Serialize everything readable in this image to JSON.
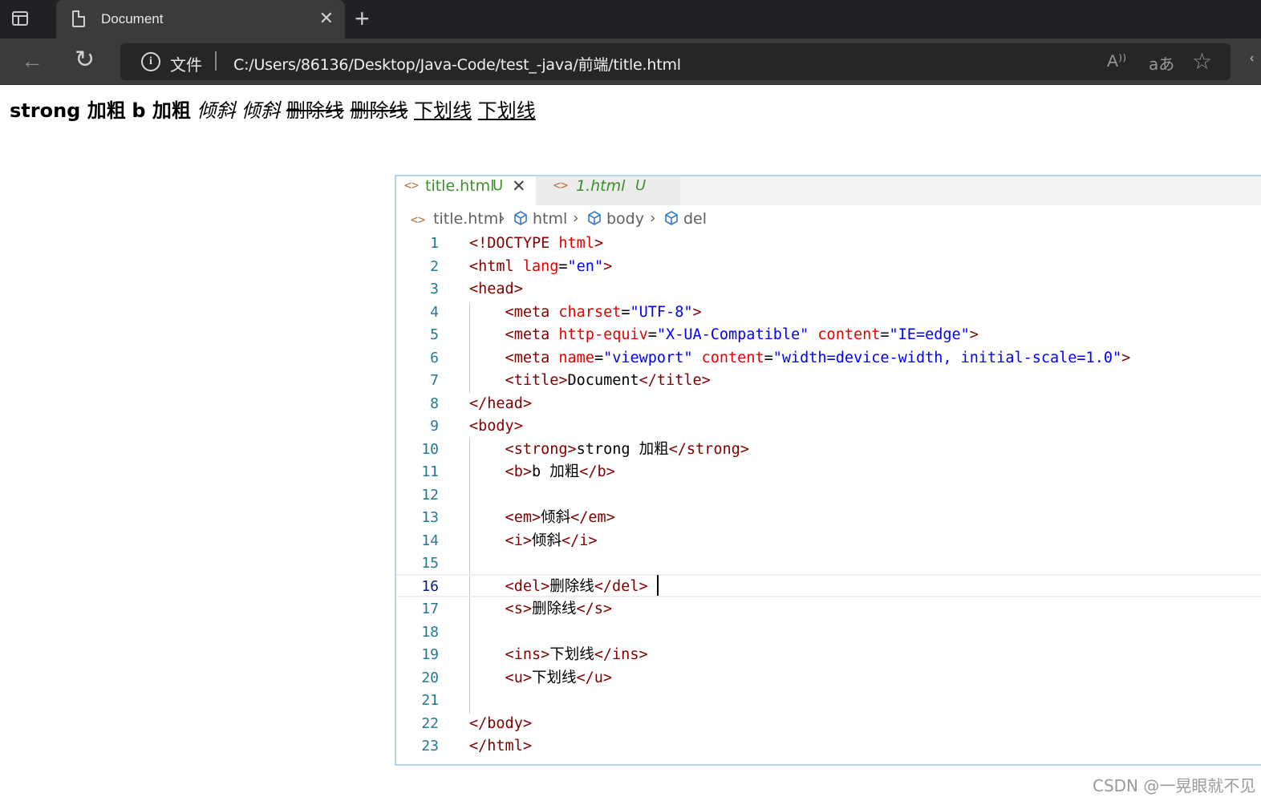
{
  "browser": {
    "tab_title": "Document",
    "tab_close": "✕",
    "new_tab": "+",
    "back": "←",
    "reload": "↻",
    "info_icon": "i",
    "file_label": "文件",
    "url": "C:/Users/86136/Desktop/Java-Code/test_-java/前端/title.html",
    "read_aloud": "A⁾⁾",
    "translate": "aあ",
    "favorite": "☆",
    "more": "‹"
  },
  "rendered": {
    "strong": "strong 加粗",
    "b": "b 加粗",
    "em": "倾斜",
    "i": "倾斜",
    "del": "删除线",
    "s": "删除线",
    "ins": "下划线",
    "u": "下划线"
  },
  "editor": {
    "tabs": [
      {
        "name": "title.html",
        "status": "U",
        "active": true,
        "close": "✕"
      },
      {
        "name": "1.html",
        "status": "U",
        "active": false
      }
    ],
    "breadcrumb": [
      "title.html",
      "html",
      "body",
      "del"
    ],
    "breadcrumb_sep": "›",
    "code_icon": "<>",
    "current_line": 16,
    "lines": [
      {
        "n": "1"
      },
      {
        "n": "2"
      },
      {
        "n": "3"
      },
      {
        "n": "4"
      },
      {
        "n": "5"
      },
      {
        "n": "6"
      },
      {
        "n": "7"
      },
      {
        "n": "8"
      },
      {
        "n": "9"
      },
      {
        "n": "10"
      },
      {
        "n": "11"
      },
      {
        "n": "12"
      },
      {
        "n": "13"
      },
      {
        "n": "14"
      },
      {
        "n": "15"
      },
      {
        "n": "16"
      },
      {
        "n": "17"
      },
      {
        "n": "18"
      },
      {
        "n": "19"
      },
      {
        "n": "20"
      },
      {
        "n": "21"
      },
      {
        "n": "22"
      },
      {
        "n": "23"
      }
    ],
    "code": {
      "l1": [
        "<!DOCTYPE ",
        "html",
        ">"
      ],
      "l2": [
        "<html ",
        "lang",
        "=",
        "\"en\"",
        ">"
      ],
      "l3": "<head>",
      "l4": [
        "    <meta ",
        "charset",
        "=",
        "\"UTF-8\"",
        ">"
      ],
      "l5": [
        "    <meta ",
        "http-equiv",
        "=",
        "\"X-UA-Compatible\"",
        " ",
        "content",
        "=",
        "\"IE=edge\"",
        ">"
      ],
      "l6": [
        "    <meta ",
        "name",
        "=",
        "\"viewport\"",
        " ",
        "content",
        "=",
        "\"width=device-width, initial-scale=1.0\"",
        ">"
      ],
      "l7": [
        "    <title>",
        "Document",
        "</title>"
      ],
      "l8": "</head>",
      "l9": "<body>",
      "l10": [
        "    <strong>",
        "strong 加粗",
        "</strong>"
      ],
      "l11": [
        "    <b>",
        "b 加粗",
        "</b>"
      ],
      "l13": [
        "    <em>",
        "倾斜",
        "</em>"
      ],
      "l14": [
        "    <i>",
        "倾斜",
        "</i>"
      ],
      "l16": [
        "    <del>",
        "删除线",
        "</del>"
      ],
      "l17": [
        "    <s>",
        "删除线",
        "</s>"
      ],
      "l19": [
        "    <ins>",
        "下划线",
        "</ins>"
      ],
      "l20": [
        "    <u>",
        "下划线",
        "</u>"
      ],
      "l22": "</body>",
      "l23": "</html>"
    }
  },
  "watermark": "CSDN @一晃眼就不见"
}
